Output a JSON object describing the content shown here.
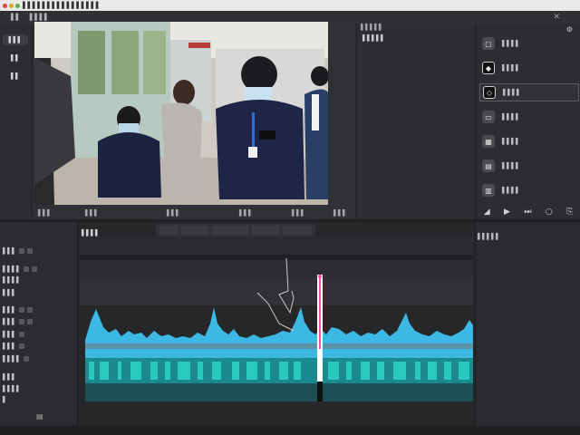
{
  "titlebar": {
    "title": "▌▌▌▌▌▌▌▌▌▌▌▌▌▌▌▌"
  },
  "menubar": {
    "items": [
      "▌▌",
      "▌▌▌▌"
    ],
    "close": "✕"
  },
  "left_panel": {
    "items": [
      "▌▌▌",
      "▌▌",
      "▌▌"
    ]
  },
  "viewer": {
    "timecode_left": "▌▌▌",
    "timecode_mid1": "▌▌▌",
    "timecode_mid2": "▌▌▌",
    "timecode_mid3": "▌▌▌",
    "timecode_mid4": "▌▌▌",
    "timecode_right": "▌▌▌"
  },
  "mid_panel": {
    "header": "▌▌▌▌▌",
    "subheader": "▌▌▌▌▌"
  },
  "right_panel": {
    "items": [
      "▌▌▌▌",
      "▌▌▌▌",
      "▌▌▌▌",
      "▌▌▌▌",
      "▌▌▌▌",
      "▌▌▌▌",
      "▌▌▌▌"
    ]
  },
  "timeline": {
    "header": "▌▌▌▌",
    "track_label": "▌▌▌▌",
    "right_header": "▌▌▌▌▌"
  },
  "tl_left": {
    "rows": [
      "▌▌▌",
      "▌▌▌▌",
      "▌▌▌▌",
      "▌▌▌",
      "▌▌▌",
      "▌▌▌",
      "▌▌▌",
      "▌▌▌",
      "▌▌▌▌",
      "▌▌▌",
      "▌▌▌▌",
      "▌"
    ]
  },
  "colors": {
    "accent": "#3db7e4",
    "teal": "#2bc9c0",
    "playhead": "#ff4fa0"
  }
}
